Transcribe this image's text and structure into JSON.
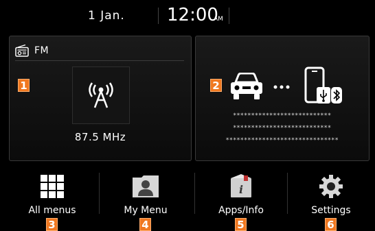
{
  "status": {
    "date": "1  Jan.",
    "time": "12:00",
    "ampm": "AM"
  },
  "radio": {
    "band": "FM",
    "frequency": "87.5 MHz"
  },
  "phone": {
    "lines": [
      "***************************",
      "***************************",
      "*******************************"
    ]
  },
  "badges": [
    "1",
    "2",
    "3",
    "4",
    "5",
    "6"
  ],
  "menu": [
    {
      "label": "All menus",
      "icon": "grid-icon"
    },
    {
      "label": "My Menu",
      "icon": "profile-folder-icon"
    },
    {
      "label": "Apps/Info",
      "icon": "info-book-icon"
    },
    {
      "label": "Settings",
      "icon": "gear-icon"
    }
  ],
  "colors": {
    "badge": "#f07820",
    "background": "#000000"
  }
}
